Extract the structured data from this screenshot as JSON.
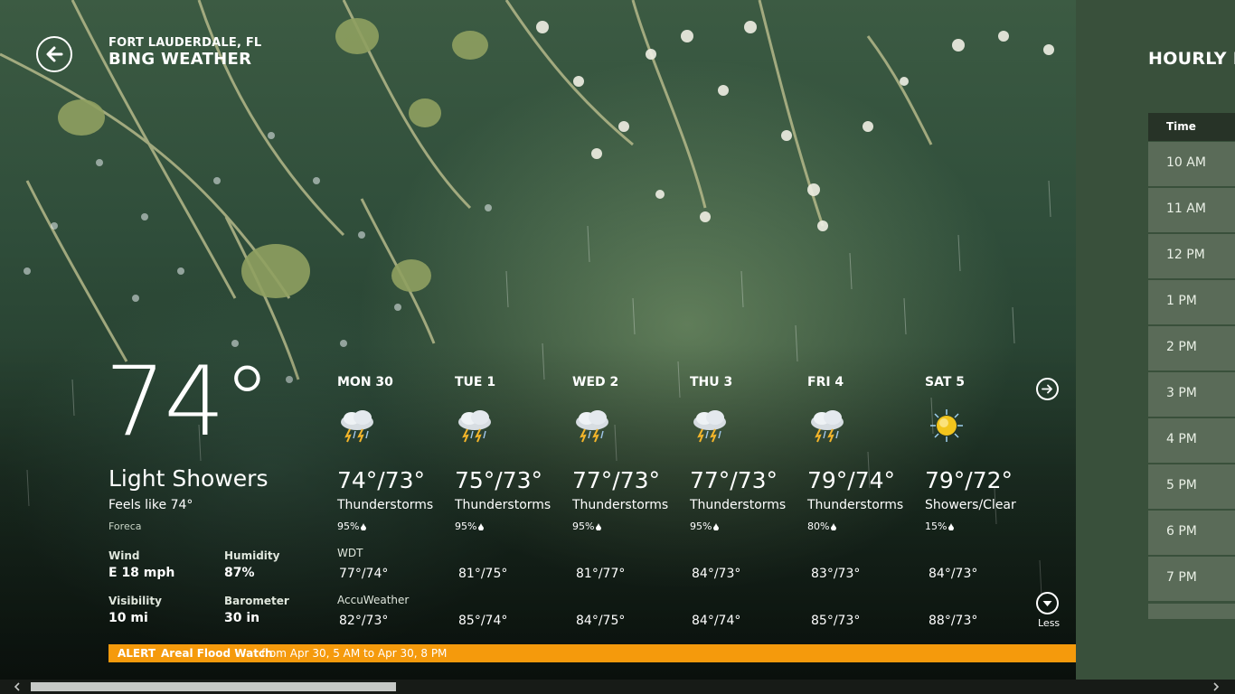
{
  "header": {
    "location": "FORT LAUDERDALE, FL",
    "app_title": "BING WEATHER"
  },
  "current": {
    "temperature": "74°",
    "condition": "Light Showers",
    "feels_like": "Feels like 74°",
    "provider": "Foreca",
    "details": [
      {
        "label": "Wind",
        "value": "E 18 mph"
      },
      {
        "label": "Humidity",
        "value": "87%"
      },
      {
        "label": "Visibility",
        "value": "10 mi"
      },
      {
        "label": "Barometer",
        "value": "30 in"
      }
    ]
  },
  "forecast": {
    "provider_labels": {
      "wdt": "WDT",
      "accuweather": "AccuWeather"
    },
    "days": [
      {
        "name": "MON 30",
        "icon": "thunderstorm-icon",
        "temp": "74°/73°",
        "condition": "Thunderstorms",
        "precip": "95%",
        "wdt": "77°/74°",
        "accuweather": "82°/73°"
      },
      {
        "name": "TUE 1",
        "icon": "thunderstorm-icon",
        "temp": "75°/73°",
        "condition": "Thunderstorms",
        "precip": "95%",
        "wdt": "81°/75°",
        "accuweather": "85°/74°"
      },
      {
        "name": "WED 2",
        "icon": "thunderstorm-icon",
        "temp": "77°/73°",
        "condition": "Thunderstorms",
        "precip": "95%",
        "wdt": "81°/77°",
        "accuweather": "84°/75°"
      },
      {
        "name": "THU 3",
        "icon": "thunderstorm-icon",
        "temp": "77°/73°",
        "condition": "Thunderstorms",
        "precip": "95%",
        "wdt": "84°/73°",
        "accuweather": "84°/74°"
      },
      {
        "name": "FRI 4",
        "icon": "thunderstorm-icon",
        "temp": "79°/74°",
        "condition": "Thunderstorms",
        "precip": "80%",
        "wdt": "83°/73°",
        "accuweather": "85°/73°"
      },
      {
        "name": "SAT 5",
        "icon": "sun-showers-icon",
        "temp": "79°/72°",
        "condition": "Showers/Clear",
        "precip": "15%",
        "wdt": "84°/73°",
        "accuweather": "88°/73°"
      }
    ],
    "less_label": "Less"
  },
  "alert": {
    "tag": "ALERT",
    "title": "Areal Flood Watch",
    "detail": "from Apr 30, 5 AM to Apr 30, 8 PM",
    "color": "#f59a0c"
  },
  "hourly": {
    "title": "HOURLY F",
    "column_header": "Time",
    "times": [
      "10 AM",
      "11 AM",
      "12 PM",
      "1 PM",
      "2 PM",
      "3 PM",
      "4 PM",
      "5 PM",
      "6 PM",
      "7 PM"
    ]
  },
  "colors": {
    "panel_bg": "#39503b",
    "row_bg": "#5a6b58",
    "header_bg": "#273327"
  }
}
